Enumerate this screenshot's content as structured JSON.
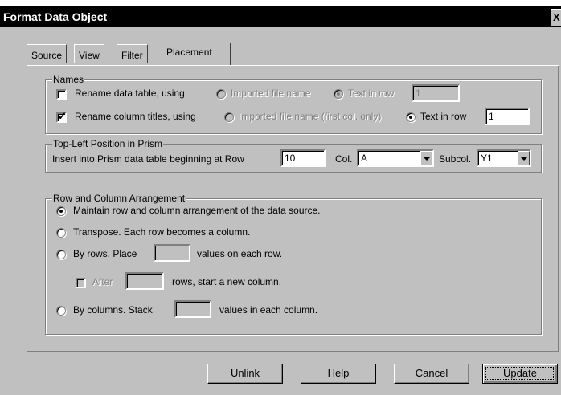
{
  "window": {
    "title": "Format Data Object",
    "close_label": "X"
  },
  "tabs": [
    {
      "label": "Source",
      "active": false
    },
    {
      "label": "View",
      "active": false
    },
    {
      "label": "Filter",
      "active": false
    },
    {
      "label": "Placement",
      "active": true
    }
  ],
  "names": {
    "legend": "Names",
    "rename_table": {
      "label": "Rename data table, using",
      "checked": false,
      "opt_imported": "Imported file name",
      "opt_text_row": "Text in row",
      "row_value": "1"
    },
    "rename_columns": {
      "label": "Rename column titles, using",
      "checked": true,
      "opt_imported": "Imported file name (first col. only)",
      "opt_text_row": "Text in row",
      "row_value": "1"
    }
  },
  "position": {
    "legend": "Top-Left Position in Prism",
    "insert_label": "Insert into Prism data table beginning at Row",
    "row_value": "10",
    "col_label": "Col.",
    "col_value": "A",
    "subcol_label": "Subcol.",
    "subcol_value": "Y1"
  },
  "arrangement": {
    "legend": "Row and Column Arrangement",
    "maintain_label": "Maintain row and column arrangement of the data source.",
    "transpose_label": "Transpose. Each row becomes a column.",
    "byrows_label": "By rows. Place",
    "byrows_suffix": "values on each row.",
    "after_label": "After",
    "after_suffix": "rows, start a new column.",
    "bycols_label": "By columns. Stack",
    "bycols_suffix": "values in each column.",
    "selected": "maintain"
  },
  "buttons": {
    "unlink": "Unlink",
    "help": "Help",
    "cancel": "Cancel",
    "update": "Update"
  }
}
